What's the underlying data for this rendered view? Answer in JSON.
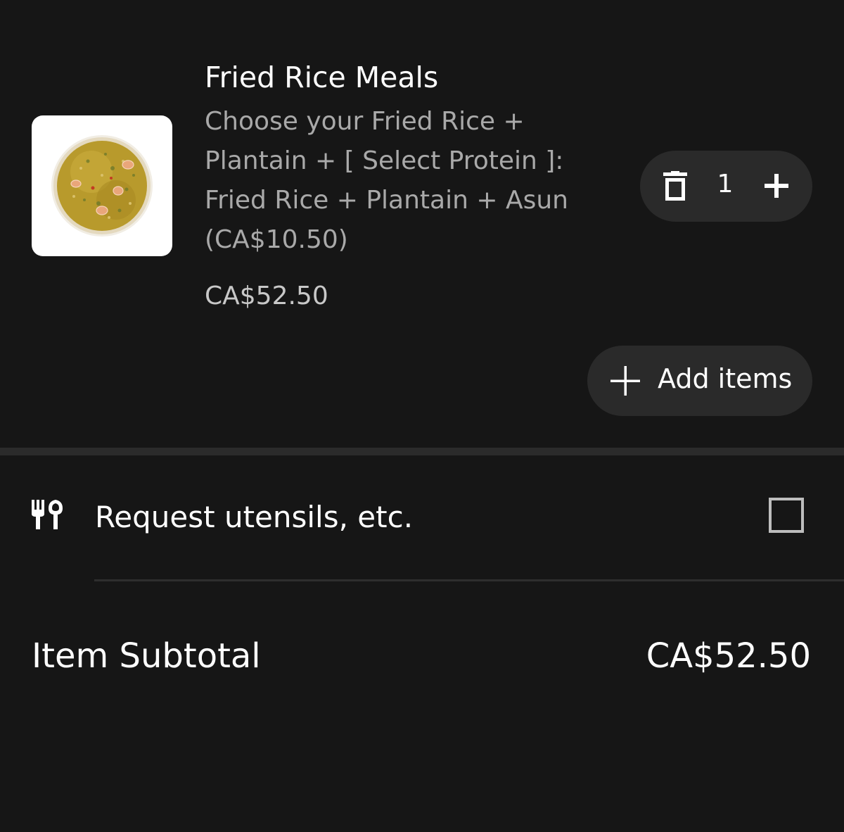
{
  "cart_item": {
    "name": "Fried Rice Meals",
    "description_lines": [
      "Choose your Fried Rice +",
      "Plantain + [ Select Protein ]:",
      "Fried Rice + Plantain + Asun",
      "(CA$10.50)"
    ],
    "price": "CA$52.50",
    "image_icon": "fried-rice-dish-photo",
    "quantity": "1",
    "trash_icon": "trash-icon",
    "plus_icon": "plus-icon"
  },
  "add_items": {
    "label": "Add items",
    "icon": "plus-icon"
  },
  "utensils": {
    "label": "Request utensils, etc.",
    "icon": "utensils-icon",
    "checked": false
  },
  "summary": {
    "subtotal_label": "Item Subtotal",
    "subtotal_value": "CA$52.50"
  },
  "colors": {
    "background": "#161616",
    "pill": "#2a2a2a",
    "secondary_text": "#a9a9a9"
  }
}
